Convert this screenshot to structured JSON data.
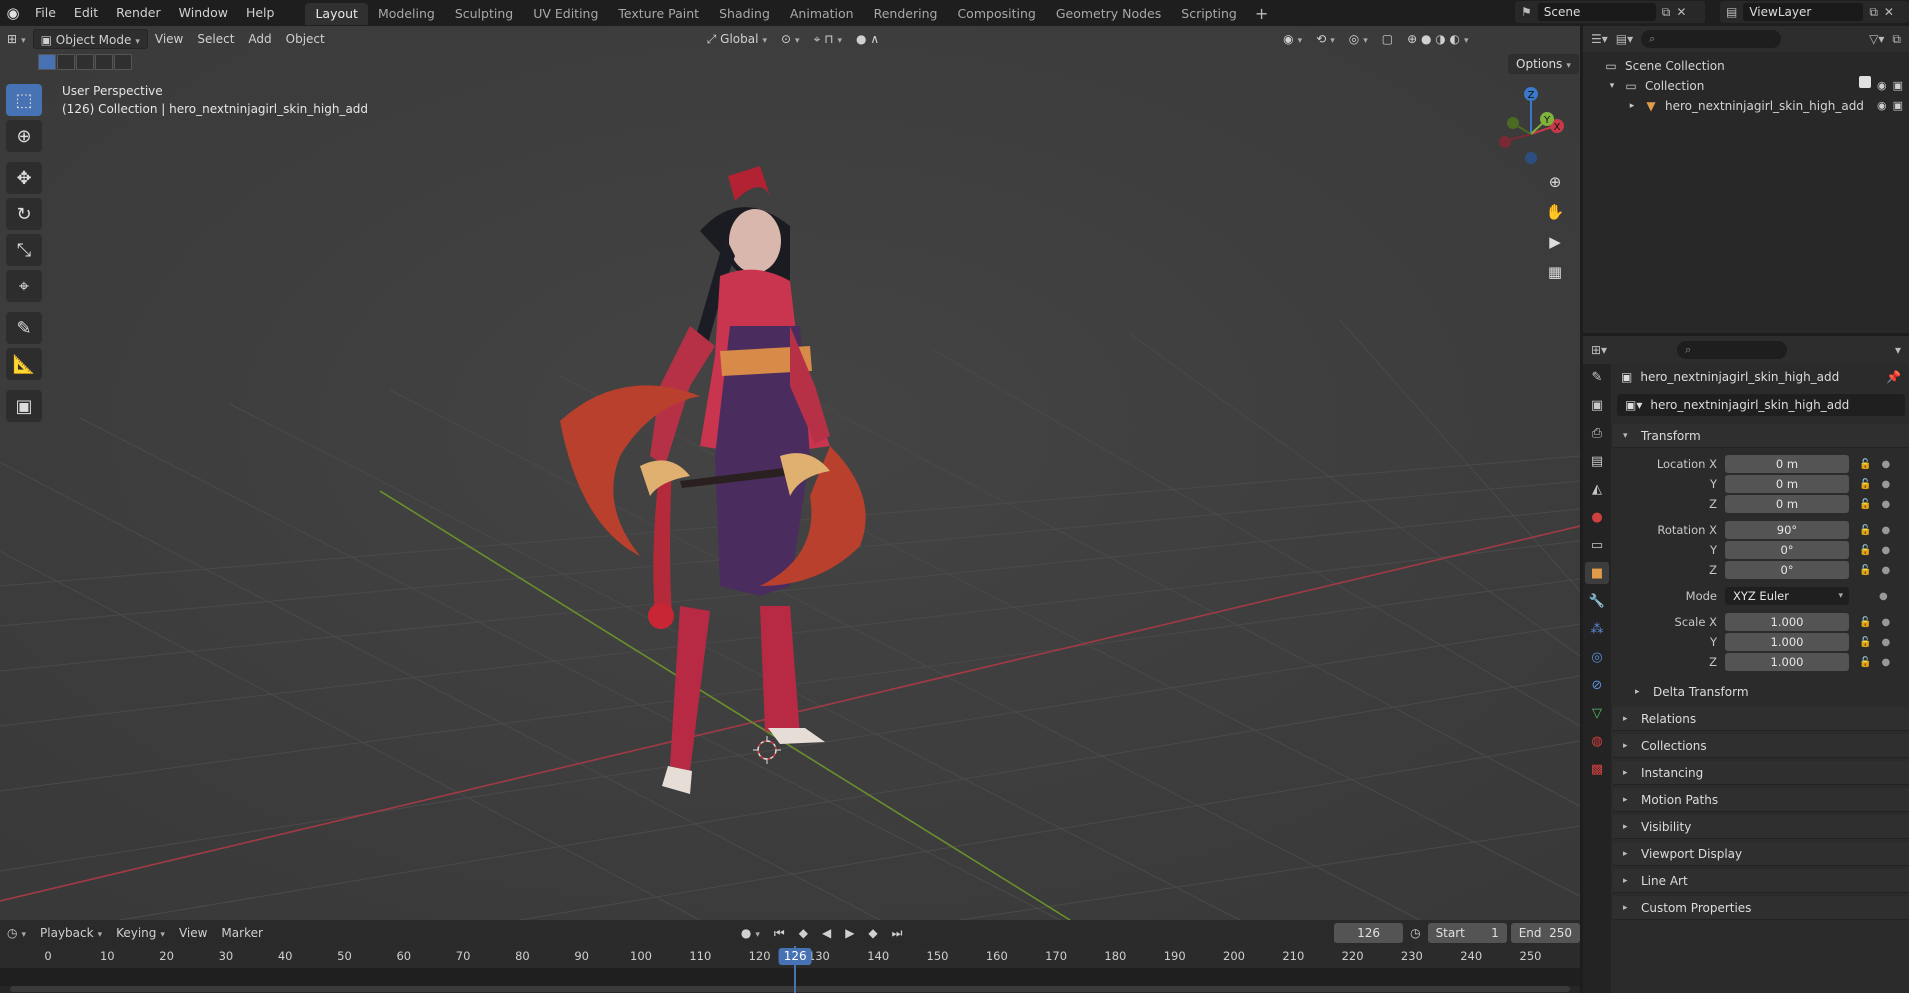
{
  "topbar": {
    "menus": [
      "File",
      "Edit",
      "Render",
      "Window",
      "Help"
    ],
    "workspaces": [
      "Layout",
      "Modeling",
      "Sculpting",
      "UV Editing",
      "Texture Paint",
      "Shading",
      "Animation",
      "Rendering",
      "Compositing",
      "Geometry Nodes",
      "Scripting"
    ],
    "active_workspace": "Layout",
    "add_workspace": "+",
    "scene": "Scene",
    "view_layer": "ViewLayer"
  },
  "viewport": {
    "mode": "Object Mode",
    "menus": [
      "View",
      "Select",
      "Add",
      "Object"
    ],
    "transform_orientation": "Global",
    "options": "Options",
    "perspective_label": "User Perspective",
    "collection_label": "(126) Collection | hero_nextninjagirl_skin_high_add",
    "gizmo_axes": {
      "x": "X",
      "y": "Y",
      "z": "Z"
    },
    "tools": [
      "select-box",
      "cursor",
      "move",
      "rotate",
      "scale",
      "transform",
      "annotate",
      "measure",
      "add-cube"
    ]
  },
  "timeline": {
    "menus": [
      "Playback",
      "Keying",
      "View",
      "Marker"
    ],
    "current_frame": "126",
    "start_label": "Start",
    "start": "1",
    "end_label": "End",
    "end": "250",
    "ticks": [
      "0",
      "10",
      "20",
      "30",
      "40",
      "50",
      "60",
      "70",
      "80",
      "90",
      "100",
      "110",
      "120",
      "130",
      "140",
      "150",
      "160",
      "170",
      "180",
      "190",
      "200",
      "210",
      "220",
      "230",
      "240",
      "250"
    ]
  },
  "outliner": {
    "rows": [
      {
        "label": "Scene Collection",
        "icon": "scene-collection-icon"
      },
      {
        "label": "Collection",
        "icon": "collection-icon"
      },
      {
        "label": "hero_nextninjagirl_skin_high_add",
        "icon": "mesh-icon"
      }
    ]
  },
  "properties": {
    "object_name": "hero_nextninjagirl_skin_high_add",
    "object_field": "hero_nextninjagirl_skin_high_add",
    "transform": {
      "title": "Transform",
      "location": {
        "label": "Location X",
        "x": "0 m",
        "y": "0 m",
        "z": "0 m"
      },
      "rotation": {
        "label": "Rotation X",
        "x": "90°",
        "y": "0°",
        "z": "0°"
      },
      "mode_label": "Mode",
      "mode": "XYZ Euler",
      "scale": {
        "label": "Scale X",
        "x": "1.000",
        "y": "1.000",
        "z": "1.000"
      },
      "y_label": "Y",
      "z_label": "Z",
      "delta": "Delta Transform"
    },
    "panels": [
      "Relations",
      "Collections",
      "Instancing",
      "Motion Paths",
      "Visibility",
      "Viewport Display",
      "Line Art",
      "Custom Properties"
    ]
  },
  "colors": {
    "accent": "#4772b3",
    "x_axis": "#c83a4a",
    "y_axis": "#7fb13b",
    "z_axis": "#3a78c8"
  }
}
